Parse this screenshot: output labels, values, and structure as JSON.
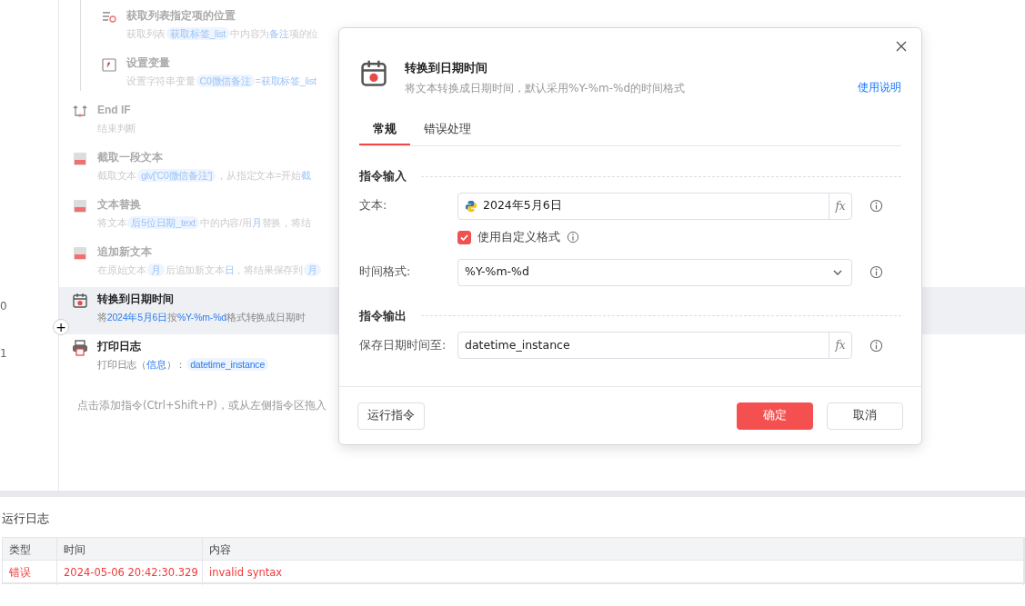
{
  "steps": [
    {
      "kind": "list-search",
      "nested": true,
      "disabled": true,
      "selected": false,
      "title": "获取列表指定项的位置",
      "desc": [
        {
          "kind": "text",
          "text": "获取列表"
        },
        {
          "kind": "chip",
          "text": "获取标签_list"
        },
        {
          "kind": "text",
          "text": "中内容为"
        },
        {
          "kind": "value",
          "text": "备注"
        },
        {
          "kind": "text",
          "text": "项的位"
        }
      ]
    },
    {
      "kind": "variable",
      "nested": true,
      "disabled": true,
      "selected": false,
      "title": "设置变量",
      "desc": [
        {
          "kind": "text",
          "text": "设置字符串变量"
        },
        {
          "kind": "chip",
          "text": "C0微信备注"
        },
        {
          "kind": "text",
          "text": "="
        },
        {
          "kind": "value",
          "text": "获取标签_list"
        }
      ]
    },
    {
      "kind": "end-if",
      "nested": false,
      "disabled": true,
      "selected": false,
      "title": "End IF",
      "desc": [
        {
          "kind": "text",
          "text": "结束判断"
        }
      ]
    },
    {
      "kind": "text-cut",
      "nested": false,
      "disabled": true,
      "selected": false,
      "title": "截取一段文本",
      "desc": [
        {
          "kind": "text",
          "text": "截取文本"
        },
        {
          "kind": "chip",
          "text": "glv['C0微信备注']"
        },
        {
          "kind": "text",
          "text": "，从指定文本=开始"
        },
        {
          "kind": "value",
          "text": "截"
        }
      ]
    },
    {
      "kind": "text-replace",
      "nested": false,
      "disabled": true,
      "selected": false,
      "title": "文本替换",
      "desc": [
        {
          "kind": "text",
          "text": "将文本"
        },
        {
          "kind": "chip",
          "text": "后5位日期_text"
        },
        {
          "kind": "text",
          "text": "中的内容/用"
        },
        {
          "kind": "value",
          "text": "月"
        },
        {
          "kind": "text",
          "text": "替换，将结"
        }
      ]
    },
    {
      "kind": "text-append",
      "nested": false,
      "disabled": true,
      "selected": false,
      "title": "追加新文本",
      "desc": [
        {
          "kind": "text",
          "text": "在原始文本"
        },
        {
          "kind": "chip",
          "text": "月"
        },
        {
          "kind": "text",
          "text": "后追加新文本"
        },
        {
          "kind": "value",
          "text": "日"
        },
        {
          "kind": "text",
          "text": "，将结果保存到"
        },
        {
          "kind": "chip",
          "text": "月"
        }
      ]
    },
    {
      "kind": "calendar",
      "nested": false,
      "disabled": false,
      "selected": true,
      "line_number": "0",
      "title": "转换到日期时间",
      "desc": [
        {
          "kind": "text",
          "text": "将"
        },
        {
          "kind": "value",
          "text": "2024年5月6日"
        },
        {
          "kind": "text",
          "text": "按"
        },
        {
          "kind": "value",
          "text": "%Y-%m-%d"
        },
        {
          "kind": "text",
          "text": "格式转换成日期时"
        }
      ]
    },
    {
      "kind": "printer",
      "nested": false,
      "disabled": false,
      "selected": false,
      "line_number": "1",
      "title": "打印日志",
      "desc": [
        {
          "kind": "text",
          "text": "打印日志（"
        },
        {
          "kind": "value",
          "text": "信息"
        },
        {
          "kind": "text",
          "text": "）："
        },
        {
          "kind": "chip",
          "text": "datetime_instance"
        }
      ]
    }
  ],
  "add_button": "+",
  "add_hint": "点击添加指令(Ctrl+Shift+P)，或从左侧指令区拖入",
  "dialog": {
    "title": "转换到日期时间",
    "subtitle": "将文本转换成日期时间，默认采用%Y-%m-%d的时间格式",
    "help_link": "使用说明",
    "tabs": [
      {
        "label": "常规",
        "selected": true
      },
      {
        "label": "错误处理",
        "selected": false
      }
    ],
    "sections": [
      {
        "title": "指令输入",
        "fields": [
          {
            "kind": "input",
            "label": "文本:",
            "value": "2024年5月6日",
            "python": true,
            "formula": "fx"
          },
          {
            "kind": "checkbox",
            "label": "使用自定义格式",
            "checked": true
          },
          {
            "kind": "select",
            "label": "时间格式:",
            "value": "%Y-%m-%d"
          }
        ]
      },
      {
        "title": "指令输出",
        "fields": [
          {
            "kind": "input",
            "label": "保存日期时间至:",
            "value": "datetime_instance",
            "python": false,
            "formula": "fx"
          }
        ]
      }
    ],
    "run_button": "运行指令",
    "ok_button": "确定",
    "cancel_button": "取消"
  },
  "log": {
    "title": "运行日志",
    "columns": [
      "类型",
      "时间",
      "内容"
    ],
    "rows": [
      {
        "kind": "error",
        "cells": [
          "错误",
          "2024-05-06 20:42:30.329",
          "invalid syntax"
        ]
      }
    ]
  }
}
